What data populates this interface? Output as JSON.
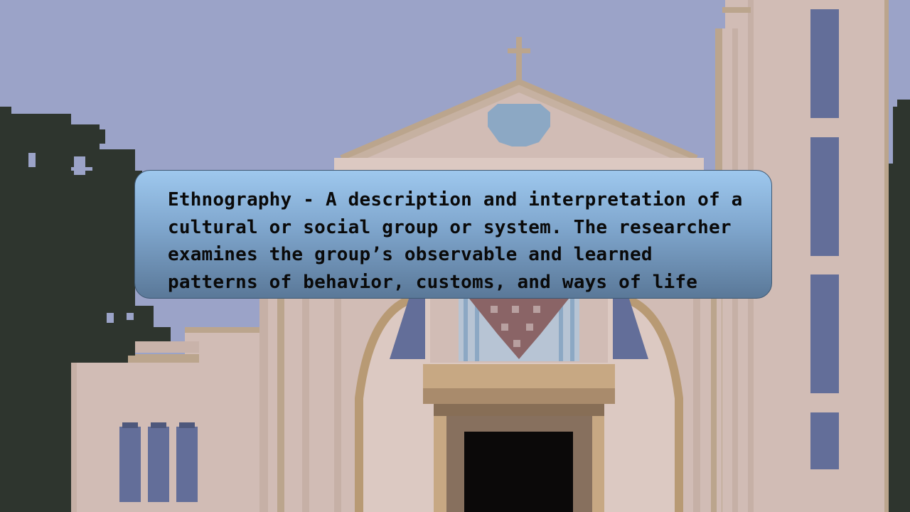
{
  "dialog": {
    "lines": [
      "Ethnography - A description and interpretation of a",
      "cultural or social group or system. The researcher",
      "examines the group’s observable and learned",
      "patterns of behavior, customs, and ways of life"
    ]
  },
  "colors": {
    "sky": "#9ba3c8",
    "wall": "#d1bcb5",
    "wall_light": "#dcc9c2",
    "trim": "#bba58d",
    "arch": "#b89a74",
    "window_blue": "#636e99",
    "tree": "#2e352e",
    "door": "#0b0909",
    "door_frame": "#87705e",
    "rose_window": "#8ca8c4",
    "dialog_top": "#9ec8ee",
    "dialog_bottom": "#5a7898"
  },
  "icons": [
    "cross-icon",
    "rose-window-icon",
    "tower-window-icon"
  ]
}
